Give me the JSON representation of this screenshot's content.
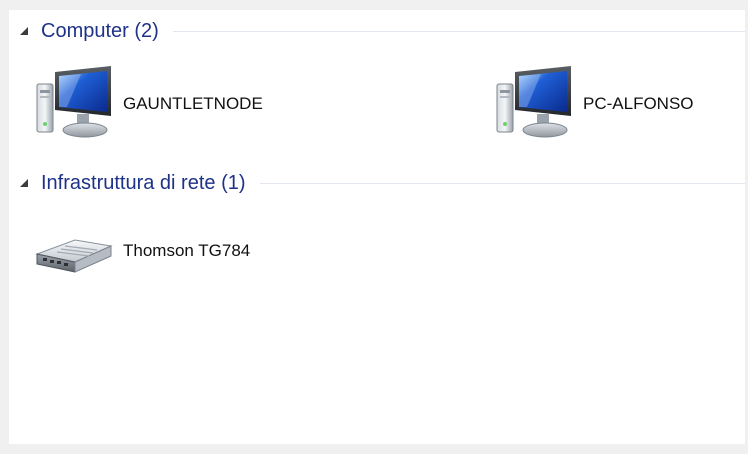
{
  "groups": [
    {
      "title": "Computer (2)",
      "items": [
        {
          "label": "GAUNTLETNODE",
          "icon": "computer-icon"
        },
        {
          "label": "PC-ALFONSO",
          "icon": "computer-icon"
        }
      ]
    },
    {
      "title": "Infrastruttura di rete (1)",
      "items": [
        {
          "label": "Thomson TG784",
          "icon": "router-icon"
        }
      ]
    }
  ],
  "colors": {
    "group_title": "#1e3287",
    "separator": "#e2e6ef",
    "background": "#ffffff"
  }
}
